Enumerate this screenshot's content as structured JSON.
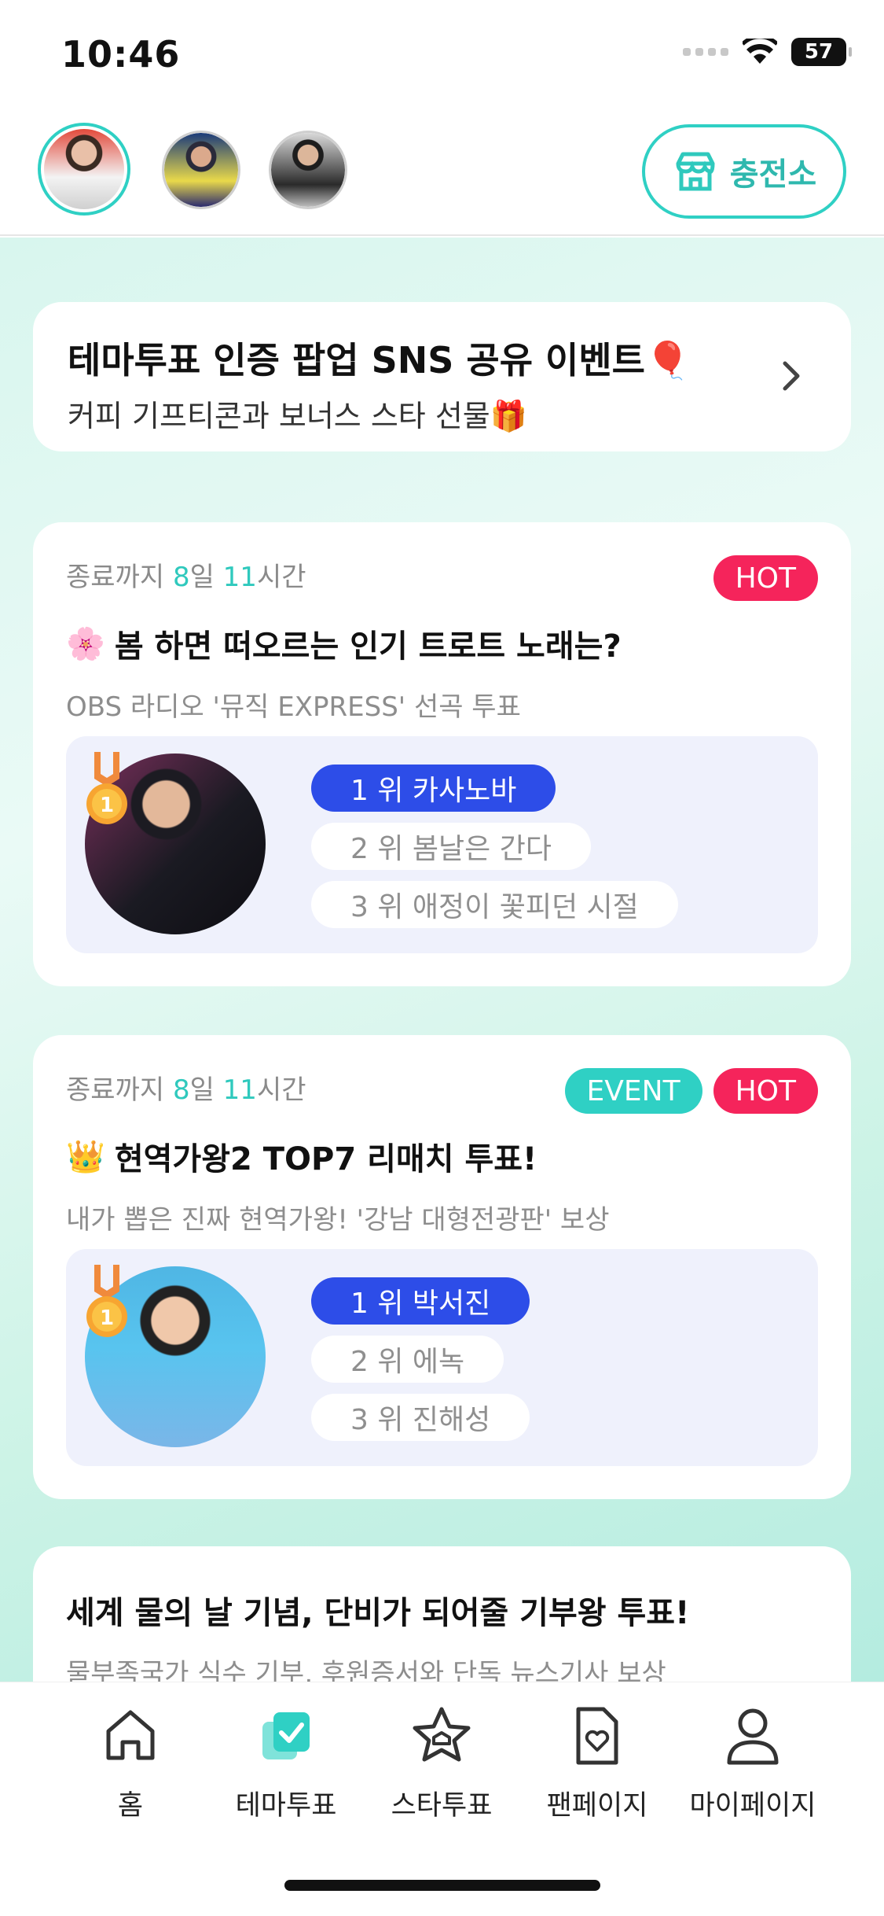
{
  "status_bar": {
    "time": "10:46",
    "battery": "57"
  },
  "header": {
    "charge_label": "충전소",
    "avatars": [
      "avatar-1",
      "avatar-2",
      "avatar-3"
    ]
  },
  "promo": {
    "title": "테마투표 인증 팝업 SNS 공유 이벤트🎈",
    "subtitle": "커피 기프티콘과 보너스 스타 선물🎁"
  },
  "votes": [
    {
      "deadline_prefix": "종료까지 ",
      "days": "8",
      "days_unit": "일 ",
      "hours": "11",
      "hours_unit": "시간",
      "badges": [
        "HOT"
      ],
      "title_emoji": "🌸",
      "title": "봄 하면 떠오르는 인기 트로트 노래는?",
      "subtitle": "OBS 라디오 '뮤직 EXPRESS' 선곡 투표",
      "ranks": [
        "1 위 카사노바",
        "2 위 봄날은 간다",
        "3 위 애정이 꽃피던 시절"
      ]
    },
    {
      "deadline_prefix": "종료까지 ",
      "days": "8",
      "days_unit": "일 ",
      "hours": "11",
      "hours_unit": "시간",
      "badges": [
        "EVENT",
        "HOT"
      ],
      "title_emoji": "👑",
      "title": "현역가왕2 TOP7 리매치 투표!",
      "subtitle": "내가 뽑은 진짜 현역가왕! '강남 대형전광판' 보상",
      "ranks": [
        "1 위 박서진",
        "2 위 에녹",
        "3 위 진해성"
      ]
    },
    {
      "title": "세계 물의 날 기념, 단비가 되어줄 기부왕 투표!",
      "subtitle": "물부족국가 식수 기부, 후원증서와 단독 뉴스기사 보상"
    }
  ],
  "nav": {
    "items": [
      {
        "label": "홈",
        "icon": "home-icon"
      },
      {
        "label": "테마투표",
        "icon": "theme-vote-icon",
        "active": true
      },
      {
        "label": "스타투표",
        "icon": "star-vote-icon"
      },
      {
        "label": "팬페이지",
        "icon": "fan-page-icon"
      },
      {
        "label": "마이페이지",
        "icon": "my-page-icon"
      }
    ]
  },
  "colors": {
    "accent": "#2fd0c4",
    "hot": "#f5245b",
    "rank_first": "#2d4de8"
  }
}
